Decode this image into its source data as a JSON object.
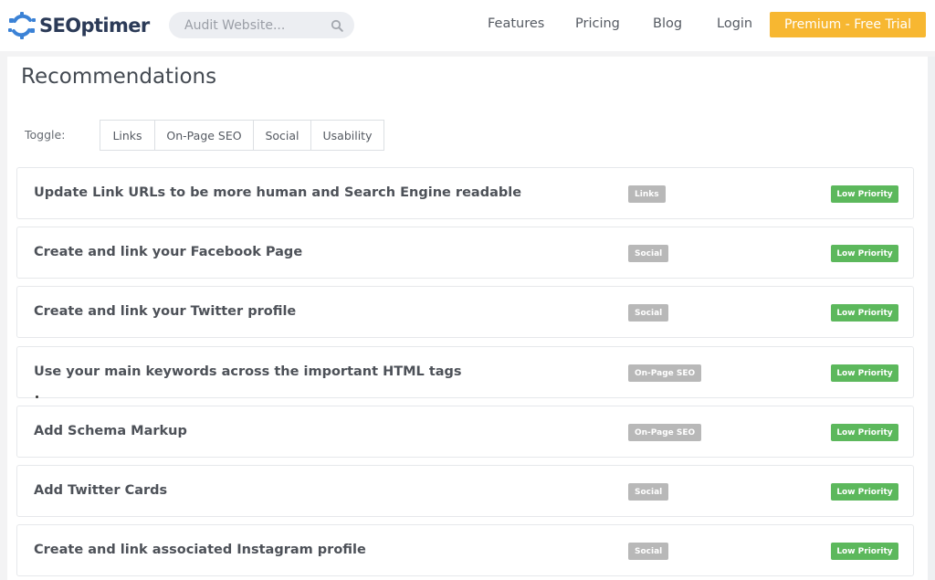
{
  "brand": {
    "name": "SEOptimer"
  },
  "search": {
    "placeholder": "Audit Website..."
  },
  "nav": {
    "links": [
      "Features",
      "Pricing",
      "Blog",
      "Login"
    ],
    "cta": "Premium - Free Trial"
  },
  "page": {
    "title": "Recommendations"
  },
  "toggle": {
    "label": "Toggle:",
    "options": [
      "Links",
      "On-Page SEO",
      "Social",
      "Usability"
    ]
  },
  "recommendations": [
    {
      "title": "Update Link URLs to be more human and Search Engine readable",
      "category": "Links",
      "priority": "Low Priority"
    },
    {
      "title": "Create and link your Facebook Page",
      "category": "Social",
      "priority": "Low Priority"
    },
    {
      "title": "Create and link your Twitter profile",
      "category": "Social",
      "priority": "Low Priority"
    },
    {
      "title": "Use your main keywords across the important HTML tags",
      "category": "On-Page SEO",
      "priority": "Low Priority"
    },
    {
      "title": "Add Schema Markup",
      "category": "On-Page SEO",
      "priority": "Low Priority"
    },
    {
      "title": "Add Twitter Cards",
      "category": "Social",
      "priority": "Low Priority"
    },
    {
      "title": "Create and link associated Instagram profile",
      "category": "Social",
      "priority": "Low Priority"
    }
  ],
  "colors": {
    "cta": "#f7b731",
    "category_badge": "#b8b8b8",
    "priority_badge": "#5cb85c",
    "logo_blue": "#3b82d6",
    "logo_text": "#2b3a57"
  }
}
